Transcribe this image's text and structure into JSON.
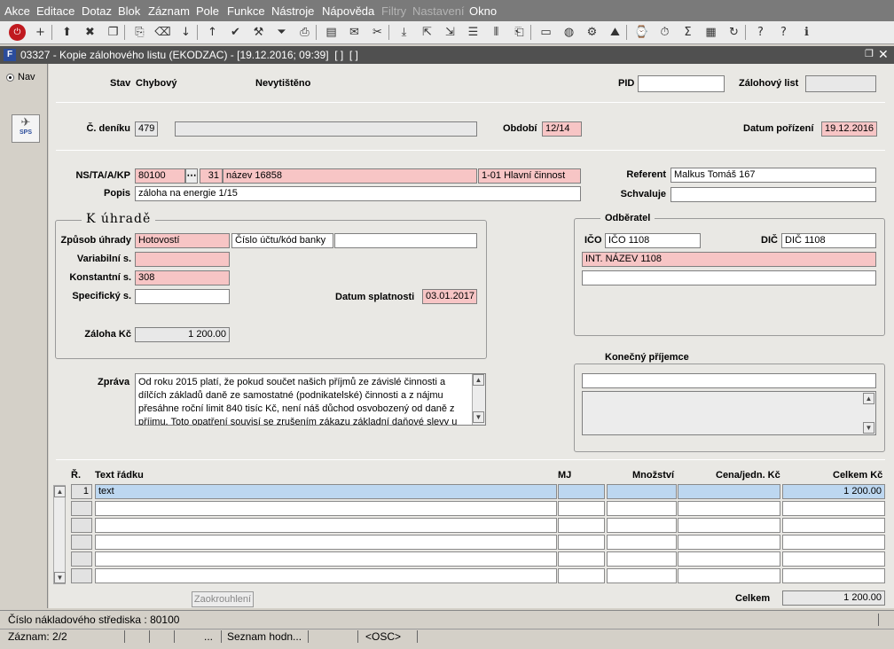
{
  "menu": [
    "Akce",
    "Editace",
    "Dotaz",
    "Blok",
    "Záznam",
    "Pole",
    "Funkce",
    "Nástroje",
    "Nápověda",
    "Filtry",
    "Nastavení",
    "Okno"
  ],
  "toolbar_icons": [
    "exit-icon",
    "add-record-icon",
    "save-record-icon",
    "delete-record-icon",
    "copy-icon",
    "duplicate-icon",
    "clear-icon",
    "sort-asc-icon",
    "sort-desc-icon",
    "check-icon",
    "wrench-icon",
    "filter-icon",
    "print-icon",
    "print-preview-icon",
    "mail-icon",
    "scissors-icon",
    "paste-icon",
    "export-icon",
    "import-icon",
    "list-icon",
    "columns-icon",
    "clipboard-icon",
    "page-icon",
    "globe-icon",
    "settings-icon",
    "chart-icon",
    "calculator-icon",
    "date-icon",
    "sum-icon",
    "excel-icon",
    "refresh-icon",
    "help-icon",
    "question-icon",
    "info-icon"
  ],
  "title": "03327 - Kopie zálohového listu (EKODZAC) - [19.12.2016; 09:39]  [ ]  [ ]",
  "nav": {
    "label": "Nav",
    "sps": "SPS"
  },
  "header": {
    "stav_label": "Stav",
    "stav_value": "Chybový",
    "tisk": "Nevytištěno",
    "pid_label": "PID",
    "pid_value": "",
    "zal_label": "Zálohový list",
    "zal_value": ""
  },
  "denik": {
    "label": "Č. deníku",
    "value": "479",
    "desc": "",
    "obdobi_label": "Období",
    "obdobi_value": "12/14",
    "datum_label": "Datum pořízení",
    "datum_value": "19.12.2016"
  },
  "ns": {
    "label": "NS/TA/A/KP",
    "ns": "80100",
    "ta": "31",
    "a": "název 16858",
    "kp": "1-01 Hlavní činnost",
    "referent_label": "Referent",
    "referent_value": "Malkus Tomáš 167",
    "popis_label": "Popis",
    "popis_value": "záloha na energie 1/15",
    "schvaluje_label": "Schvaluje",
    "schvaluje_value": ""
  },
  "uhrada": {
    "title": "K úhradě",
    "zpusob_label": "Způsob úhrady",
    "zpusob_value": "Hotovostí",
    "ucet_label": "Číslo účtu/kód banky",
    "ucet_value": "",
    "var_label": "Variabilní s.",
    "var_value": "",
    "konst_label": "Konstantní s.",
    "konst_value": "308",
    "spec_label": "Specifický s.",
    "spec_value": "",
    "splat_label": "Datum splatnosti",
    "splat_value": "03.01.2017",
    "zaloha_label": "Záloha Kč",
    "zaloha_value": "1 200.00"
  },
  "odberatel": {
    "title": "Odběratel",
    "ico_label": "IČO",
    "ico_value": "IČO 1108",
    "dic_label": "DIČ",
    "dic_value": "DIČ 1108",
    "nazev": "INT. NÁZEV 1108",
    "adresa": ""
  },
  "zprava": {
    "label": "Zpráva",
    "text": "Od roku 2015 platí, že pokud součet našich příjmů ze závislé činnosti a dílčích základů daně ze samostatné (podnikatelské) činnosti a z nájmu přesáhne roční limit 840 tisíc Kč, není náš důchod osvobozený od daně z příjmu. Toto opatření souvisí se zrušením zákazu základní daňové slevy u"
  },
  "prijemce": {
    "title": "Konečný příjemce",
    "value": "",
    "note": ""
  },
  "table": {
    "headers": {
      "r": "Ř.",
      "text": "Text řádku",
      "mj": "MJ",
      "mnozstvi": "Množství",
      "cena": "Cena/jedn. Kč",
      "celkem": "Celkem Kč"
    },
    "rows": [
      {
        "r": "1",
        "text": "text",
        "mj": "",
        "mnozstvi": "",
        "cena": "",
        "celkem": "1 200.00"
      },
      {
        "r": "",
        "text": "",
        "mj": "",
        "mnozstvi": "",
        "cena": "",
        "celkem": ""
      },
      {
        "r": "",
        "text": "",
        "mj": "",
        "mnozstvi": "",
        "cena": "",
        "celkem": ""
      },
      {
        "r": "",
        "text": "",
        "mj": "",
        "mnozstvi": "",
        "cena": "",
        "celkem": ""
      },
      {
        "r": "",
        "text": "",
        "mj": "",
        "mnozstvi": "",
        "cena": "",
        "celkem": ""
      },
      {
        "r": "",
        "text": "",
        "mj": "",
        "mnozstvi": "",
        "cena": "",
        "celkem": ""
      }
    ]
  },
  "footer": {
    "round_label": "Zaokrouhlení",
    "total_label": "Celkem",
    "total_value": "1 200.00"
  },
  "status": {
    "line1": "Číslo nákladového střediska : 80100",
    "zaznam": "Záznam: 2/2",
    "ell": "...",
    "seznam": "Seznam hodn...",
    "osc": "<OSC>"
  },
  "colors": {
    "menubar": "#7a7a7a",
    "titlebar": "#505050",
    "required": "#f7c5c5",
    "selected_row": "#bdd7f0"
  }
}
